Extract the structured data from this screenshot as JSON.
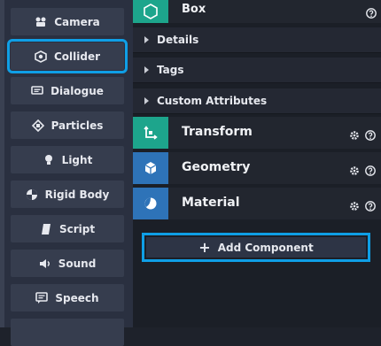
{
  "left_menu": {
    "items": [
      {
        "label": "Camera",
        "icon": "camera-icon"
      },
      {
        "label": "Collider",
        "icon": "collider-icon",
        "selected": true
      },
      {
        "label": "Dialogue",
        "icon": "dialogue-icon"
      },
      {
        "label": "Particles",
        "icon": "particles-icon"
      },
      {
        "label": "Light",
        "icon": "light-icon"
      },
      {
        "label": "Rigid Body",
        "icon": "rigid-body-icon"
      },
      {
        "label": "Script",
        "icon": "script-icon"
      },
      {
        "label": "Sound",
        "icon": "sound-icon"
      },
      {
        "label": "Speech",
        "icon": "speech-icon"
      }
    ]
  },
  "entity": {
    "title": "Box",
    "icon": "hexagon-icon"
  },
  "sections": [
    {
      "label": "Details"
    },
    {
      "label": "Tags"
    },
    {
      "label": "Custom Attributes"
    }
  ],
  "components": [
    {
      "label": "Transform",
      "icon": "transform-icon",
      "color": "#1da58c"
    },
    {
      "label": "Geometry",
      "icon": "geometry-icon",
      "color": "#2e73b8"
    },
    {
      "label": "Material",
      "icon": "material-icon",
      "color": "#2e73b8"
    }
  ],
  "add_component": {
    "label": "Add Component"
  },
  "colors": {
    "accent": "#0f9fe6",
    "teal": "#1da58c",
    "blue": "#2e73b8"
  }
}
